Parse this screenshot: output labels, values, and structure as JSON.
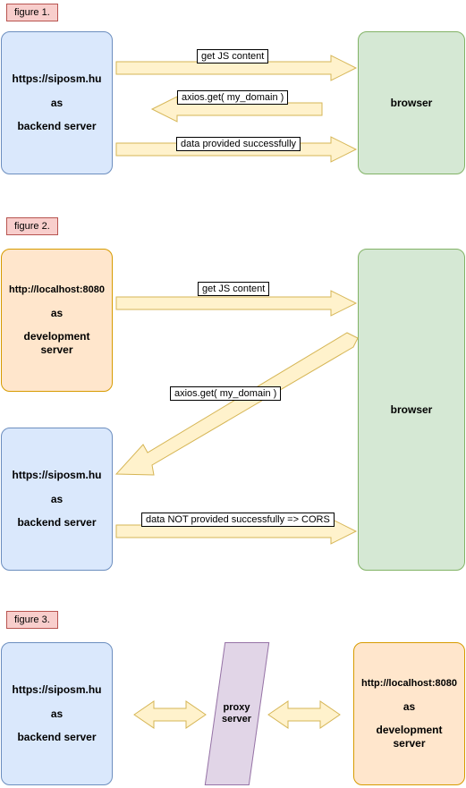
{
  "figures": {
    "fig1": "figure 1.",
    "fig2": "figure 2.",
    "fig3": "figure 3."
  },
  "boxes": {
    "backend1_l1": "https://siposm.hu",
    "backend1_l2": "as",
    "backend1_l3": "backend server",
    "browser1": "browser",
    "dev_l1": "http://localhost:8080",
    "dev_l2": "as",
    "dev_l3": "development server",
    "backend2_l1": "https://siposm.hu",
    "backend2_l2": "as",
    "backend2_l3": "backend server",
    "browser2": "browser",
    "backend3_l1": "https://siposm.hu",
    "backend3_l2": "as",
    "backend3_l3": "backend server",
    "proxy_l1": "proxy",
    "proxy_l2": "server",
    "dev3_l1": "http://localhost:8080",
    "dev3_l2": "as",
    "dev3_l3": "development server"
  },
  "arrows": {
    "a1": "get JS content",
    "a2": "axios.get( my_domain )",
    "a3": "data provided successfully",
    "a4": "get JS content",
    "a5": "axios.get( my_domain )",
    "a6": "data NOT provided successfully => CORS"
  }
}
